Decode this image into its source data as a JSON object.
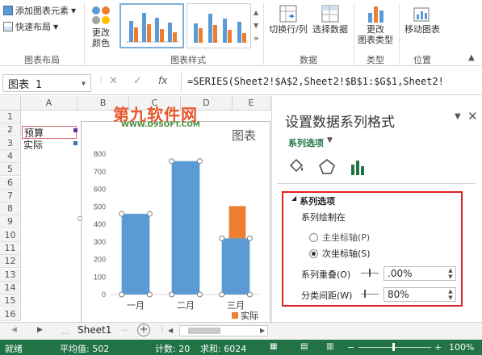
{
  "ribbon": {
    "add_element": "添加图表元素",
    "quick_layout": "快速布局",
    "change_color_line1": "更改",
    "change_color_line2": "颜色",
    "switch_row_col": "切换行/列",
    "select_data": "选择数据",
    "change_type_line1": "更改",
    "change_type_line2": "图表类型",
    "move_chart": "移动图表",
    "groups": [
      "图表布局",
      "图表样式",
      "数据",
      "类型",
      "位置"
    ]
  },
  "formula_bar": {
    "name_box": "图表 1",
    "fx": "fx",
    "formula": "=SERIES(Sheet2!$A$2,Sheet2!$B$1:$G$1,Sheet2!"
  },
  "sheet": {
    "columns": [
      "A",
      "B",
      "C",
      "D",
      "E"
    ],
    "rows": [
      "1",
      "2",
      "3",
      "4",
      "5",
      "6",
      "7",
      "8",
      "9",
      "10",
      "11",
      "12",
      "13",
      "14",
      "15",
      "16"
    ],
    "cells": {
      "A2": "预算",
      "A3": "实际"
    }
  },
  "chart_data": {
    "type": "bar",
    "title": "图表",
    "categories": [
      "一月",
      "二月",
      "三月"
    ],
    "yticks": [
      "800",
      "700",
      "600",
      "500",
      "400",
      "300",
      "200",
      "100",
      "0"
    ],
    "ylim": [
      0,
      800
    ],
    "series": [
      {
        "name": "预算",
        "values": [
          460,
          760,
          320
        ],
        "color": "#5b9bd5"
      },
      {
        "name": "实际",
        "values": [
          null,
          null,
          110
        ],
        "color": "#ed7d31"
      }
    ],
    "legend_label": "实际"
  },
  "pane": {
    "title": "设置数据系列格式",
    "options_dropdown": "系列选项",
    "section": "系列选项",
    "plot_on": "系列绘制在",
    "primary_axis": "主坐标轴(P)",
    "secondary_axis": "次坐标轴(S)",
    "overlap_label": "系列重叠(O)",
    "overlap_value": ".00%",
    "gap_label": "分类间距(W)",
    "gap_value": "80%"
  },
  "watermark": {
    "line1": "第九软件网",
    "line2": "WWW.D9SOFT.COM"
  },
  "tabs": {
    "sheet": "Sheet1"
  },
  "status": {
    "ready": "就绪",
    "average": "平均值: 502",
    "count": "计数: 20",
    "sum": "求和: 6024",
    "zoom": "100%"
  }
}
